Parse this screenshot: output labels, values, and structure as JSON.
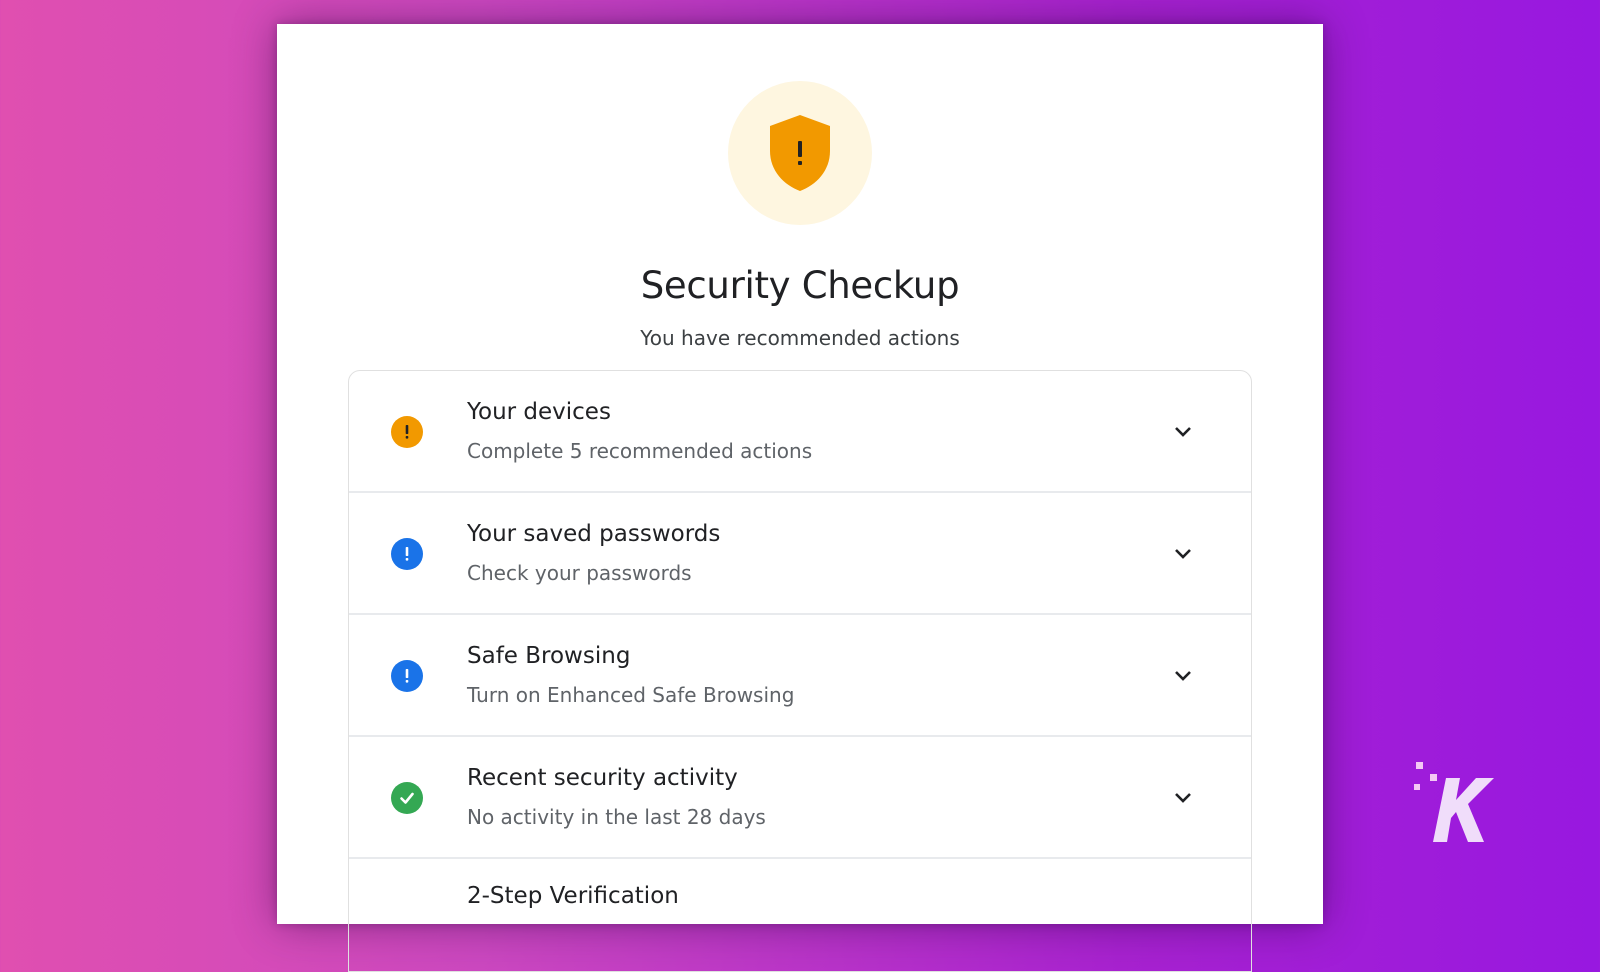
{
  "header": {
    "icon": "shield-warning-icon",
    "title": "Security Checkup",
    "subtitle": "You have recommended actions"
  },
  "items": [
    {
      "title": "Your devices",
      "subtitle": "Complete 5 recommended actions",
      "status": "warning",
      "status_icon": "exclamation-icon",
      "color": "#f29900"
    },
    {
      "title": "Your saved passwords",
      "subtitle": "Check your passwords",
      "status": "info",
      "status_icon": "exclamation-icon",
      "color": "#1a73e8"
    },
    {
      "title": "Safe Browsing",
      "subtitle": "Turn on Enhanced Safe Browsing",
      "status": "info",
      "status_icon": "exclamation-icon",
      "color": "#1a73e8"
    },
    {
      "title": "Recent security activity",
      "subtitle": "No activity in the last 28 days",
      "status": "ok",
      "status_icon": "checkmark-icon",
      "color": "#34a853"
    },
    {
      "title": "2-Step Verification",
      "subtitle": "",
      "status": "partial"
    }
  ],
  "colors": {
    "shield": "#f29900",
    "shield_bg": "#fef6e0"
  },
  "watermark": {
    "icon": "k-logo-icon",
    "text": "K"
  }
}
